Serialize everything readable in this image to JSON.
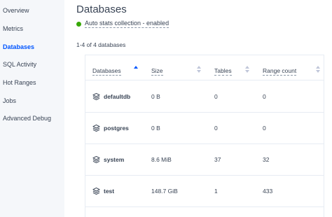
{
  "sidebar": {
    "items": [
      {
        "label": "Overview",
        "active": false
      },
      {
        "label": "Metrics",
        "active": false
      },
      {
        "label": "Databases",
        "active": true
      },
      {
        "label": "SQL Activity",
        "active": false
      },
      {
        "label": "Hot Ranges",
        "active": false
      },
      {
        "label": "Jobs",
        "active": false
      },
      {
        "label": "Advanced Debug",
        "active": false
      }
    ]
  },
  "page": {
    "title": "Databases",
    "stats_label": "Auto stats collection - enabled",
    "count_label": "1-4 of 4 databases"
  },
  "table": {
    "columns": [
      {
        "label": "Databases",
        "sort": "asc"
      },
      {
        "label": "Size",
        "sort": "none"
      },
      {
        "label": "Tables",
        "sort": "none"
      },
      {
        "label": "Range count",
        "sort": "none"
      }
    ],
    "rows": [
      {
        "name": "defaultdb",
        "size": "0 B",
        "tables": "0",
        "ranges": "0"
      },
      {
        "name": "postgres",
        "size": "0 B",
        "tables": "0",
        "ranges": "0"
      },
      {
        "name": "system",
        "size": "8.6 MiB",
        "tables": "37",
        "ranges": "32"
      },
      {
        "name": "test",
        "size": "148.7 GiB",
        "tables": "1",
        "ranges": "433"
      }
    ]
  },
  "colors": {
    "accent": "#0055ff",
    "status_green": "#37a806",
    "text": "#394455",
    "sidebar_bg": "#f5f7fa"
  },
  "icons": {
    "db_icon": "stack-icon",
    "sort_icon": "sort-arrows-icon",
    "status_icon": "green-dot-icon"
  }
}
